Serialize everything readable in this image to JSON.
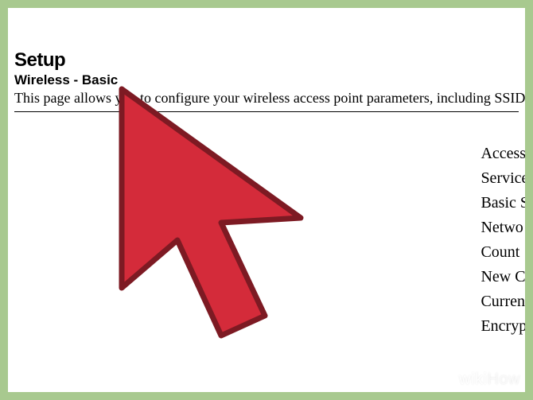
{
  "header": {
    "title": "Setup",
    "subtitle": "Wireless - Basic",
    "description": "This page allows you to configure your wireless access point parameters, including SSID"
  },
  "side_list": {
    "items": [
      "Access",
      "Service",
      "Basic S",
      "Netwo",
      "Count",
      "New C",
      "Curren",
      "Encryp"
    ]
  },
  "watermark": {
    "prefix": "wiki",
    "suffix": "How"
  }
}
